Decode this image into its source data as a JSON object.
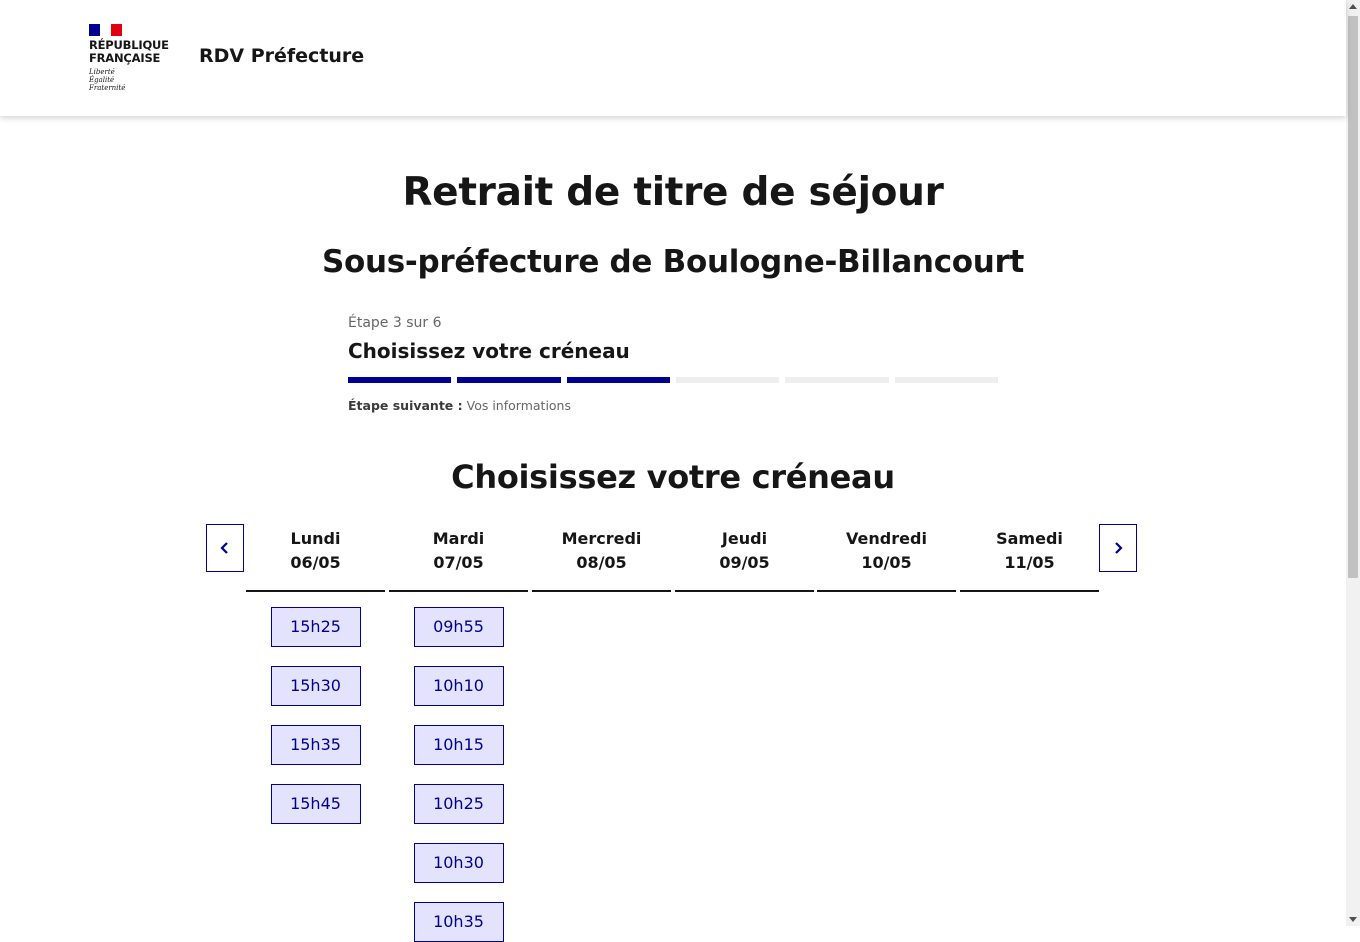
{
  "header": {
    "logo": {
      "line1": "RÉPUBLIQUE",
      "line2": "FRANÇAISE",
      "motto": [
        "Liberté",
        "Égalité",
        "Fraternité"
      ]
    },
    "service_title": "RDV Préfecture"
  },
  "page": {
    "title": "Retrait de titre de séjour",
    "subtitle": "Sous-préfecture de Boulogne-Billancourt"
  },
  "stepper": {
    "state": "Étape 3 sur 6",
    "title": "Choisissez votre créneau",
    "current_step": 3,
    "total_steps": 6,
    "next_label": "Étape suivante :",
    "next_value": "Vos informations"
  },
  "calendar": {
    "title": "Choisissez votre créneau",
    "prev_icon": "chevron-left-icon",
    "next_icon": "chevron-right-icon",
    "days": [
      {
        "name": "Lundi",
        "date": "06/05",
        "slots": [
          "15h25",
          "15h30",
          "15h35",
          "15h45"
        ]
      },
      {
        "name": "Mardi",
        "date": "07/05",
        "slots": [
          "09h55",
          "10h10",
          "10h15",
          "10h25",
          "10h30",
          "10h35"
        ]
      },
      {
        "name": "Mercredi",
        "date": "08/05",
        "slots": []
      },
      {
        "name": "Jeudi",
        "date": "09/05",
        "slots": []
      },
      {
        "name": "Vendredi",
        "date": "10/05",
        "slots": []
      },
      {
        "name": "Samedi",
        "date": "11/05",
        "slots": []
      }
    ]
  },
  "colors": {
    "primary": "#000091",
    "slot_background": "#e3e3fd",
    "flag_red": "#e1000f"
  }
}
